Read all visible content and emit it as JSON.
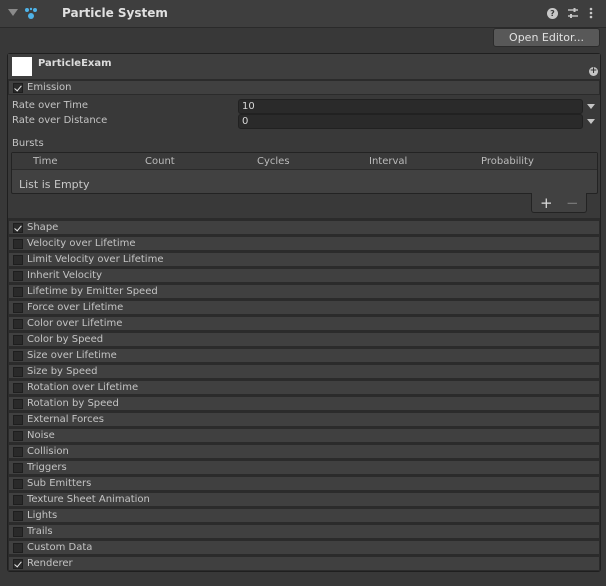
{
  "header": {
    "title": "Particle System"
  },
  "toolbar": {
    "open_editor_label": "Open Editor..."
  },
  "system": {
    "name": "ParticleExam"
  },
  "emission": {
    "label": "Emission",
    "rate_over_time_label": "Rate over Time",
    "rate_over_time_value": "10",
    "rate_over_distance_label": "Rate over Distance",
    "rate_over_distance_value": "0",
    "bursts_label": "Bursts",
    "bursts_columns": [
      "Time",
      "Count",
      "Cycles",
      "Interval",
      "Probability"
    ],
    "bursts_empty": "List is Empty",
    "add": "+",
    "remove": "−"
  },
  "modules": [
    {
      "label": "Shape",
      "enabled": true
    },
    {
      "label": "Velocity over Lifetime",
      "enabled": false
    },
    {
      "label": "Limit Velocity over Lifetime",
      "enabled": false
    },
    {
      "label": "Inherit Velocity",
      "enabled": false
    },
    {
      "label": "Lifetime by Emitter Speed",
      "enabled": false
    },
    {
      "label": "Force over Lifetime",
      "enabled": false
    },
    {
      "label": "Color over Lifetime",
      "enabled": false
    },
    {
      "label": "Color by Speed",
      "enabled": false
    },
    {
      "label": "Size over Lifetime",
      "enabled": false
    },
    {
      "label": "Size by Speed",
      "enabled": false
    },
    {
      "label": "Rotation over Lifetime",
      "enabled": false
    },
    {
      "label": "Rotation by Speed",
      "enabled": false
    },
    {
      "label": "External Forces",
      "enabled": false
    },
    {
      "label": "Noise",
      "enabled": false
    },
    {
      "label": "Collision",
      "enabled": false
    },
    {
      "label": "Triggers",
      "enabled": false
    },
    {
      "label": "Sub Emitters",
      "enabled": false
    },
    {
      "label": "Texture Sheet Animation",
      "enabled": false
    },
    {
      "label": "Lights",
      "enabled": false
    },
    {
      "label": "Trails",
      "enabled": false
    },
    {
      "label": "Custom Data",
      "enabled": false
    },
    {
      "label": "Renderer",
      "enabled": true
    }
  ]
}
